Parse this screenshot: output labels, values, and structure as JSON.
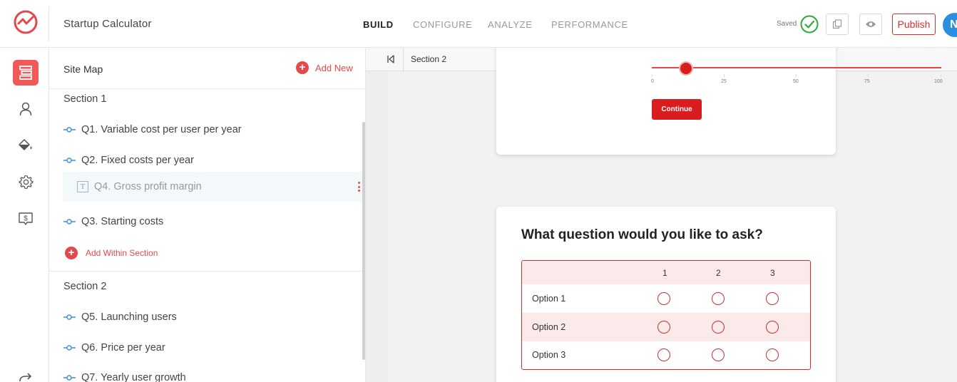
{
  "app": {
    "title": "Startup Calculator",
    "avatar_initial": "N",
    "accent_color": "#e5484a",
    "brand_red": "#d71d1d"
  },
  "nav": {
    "tabs": [
      {
        "label": "BUILD",
        "active": true
      },
      {
        "label": "CONFIGURE",
        "active": false
      },
      {
        "label": "ANALYZE",
        "active": false
      },
      {
        "label": "PERFORMANCE",
        "active": false
      }
    ]
  },
  "header_actions": {
    "saved_label": "Saved",
    "publish_label": "Publish"
  },
  "rail": {
    "items": [
      "sitemap-icon",
      "user-icon",
      "paint-bucket-icon",
      "gear-icon",
      "dollar-icon"
    ]
  },
  "sitemap": {
    "title": "Site Map",
    "add_new_label": "Add New",
    "add_within_label": "Add Within Section",
    "sections": [
      {
        "title": "Section 1",
        "questions": [
          "Q1. Variable cost per user per year",
          "Q2. Fixed costs per year",
          "Q4. Gross profit margin",
          "Q3. Starting costs"
        ]
      },
      {
        "title": "Section 2",
        "questions": [
          "Q5. Launching users",
          "Q6. Price per year",
          "Q7. Yearly user growth"
        ]
      }
    ]
  },
  "toolbar": {
    "section_select_value": "Section 2"
  },
  "preview": {
    "slider": {
      "ticks": [
        "0",
        "25",
        "50",
        "75",
        "100"
      ],
      "value": 12
    },
    "continue_label": "Continue",
    "question": "What question would you like to ask?",
    "matrix": {
      "columns": [
        "1",
        "2",
        "3"
      ],
      "rows": [
        "Option 1",
        "Option 2",
        "Option 3"
      ]
    }
  }
}
